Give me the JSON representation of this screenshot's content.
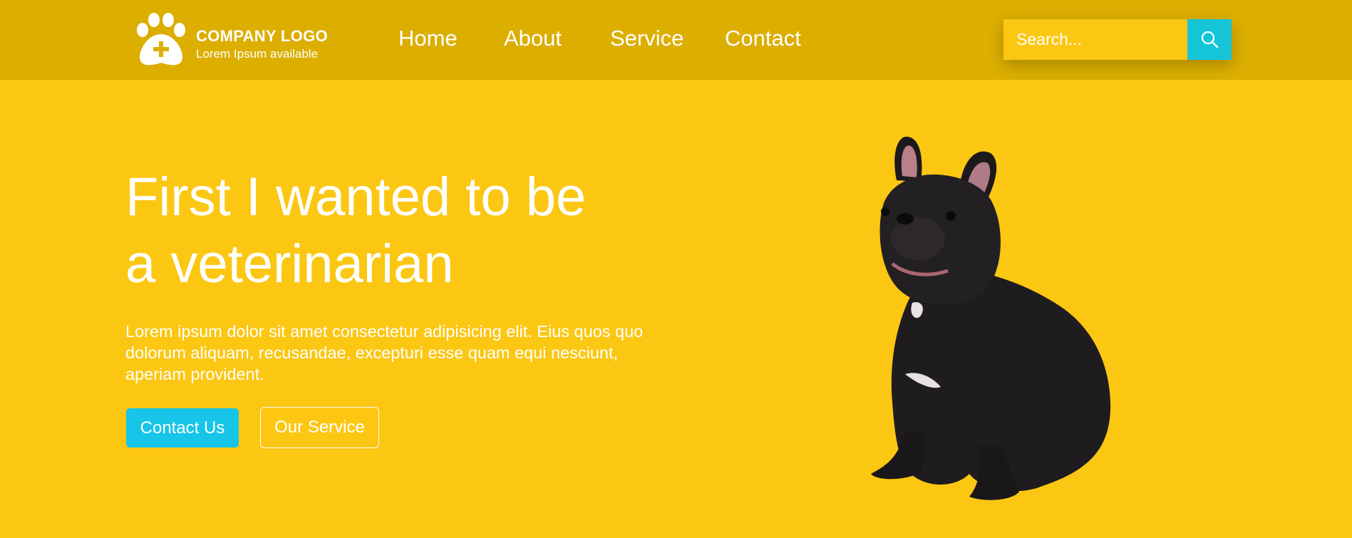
{
  "header": {
    "logo": {
      "icon": "paw-plus-icon",
      "title": "COMPANY LOGO",
      "subtitle": "Lorem Ipsum available"
    },
    "nav": [
      {
        "label": "Home"
      },
      {
        "label": "About"
      },
      {
        "label": "Service"
      },
      {
        "label": "Contact"
      }
    ],
    "search": {
      "placeholder": "Search...",
      "icon": "search-icon"
    }
  },
  "hero": {
    "title_line1": "First I wanted to be",
    "title_line2": "a veterinarian",
    "text": "Lorem ipsum dolor sit amet consectetur adipisicing elit. Eius quos quo dolorum aliquam, recusandae, excepturi esse quam equi nesciunt, aperiam provident.",
    "primary_button": "Contact Us",
    "secondary_button": "Our Service",
    "image": "french-bulldog-image"
  },
  "colors": {
    "header_bg": "#DBAE00",
    "page_bg": "#FBC713",
    "accent": "#16C5E8",
    "text": "#FFFFFF"
  }
}
